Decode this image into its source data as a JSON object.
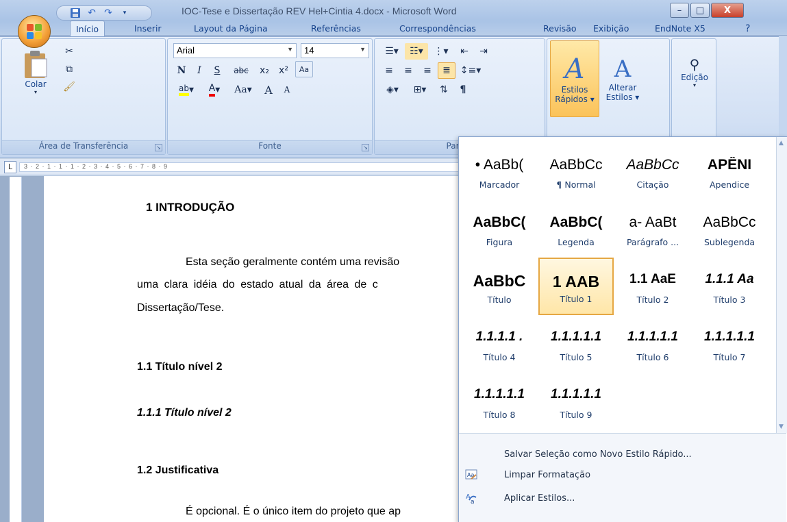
{
  "window": {
    "title": "IOC-Tese e Dissertação REV Hel+Cintia 4.docx - Microsoft Word",
    "min_label": "–",
    "max_label": "□",
    "close_label": "X"
  },
  "qat": {
    "save_icon": "save-icon",
    "undo_icon": "undo-icon",
    "redo_icon": "redo-icon"
  },
  "tabs": [
    {
      "label": "Início",
      "active": true
    },
    {
      "label": "Inserir"
    },
    {
      "label": "Layout da Página"
    },
    {
      "label": "Referências"
    },
    {
      "label": "Correspondências"
    },
    {
      "label": "Revisão"
    },
    {
      "label": "Exibição"
    },
    {
      "label": "EndNote X5"
    }
  ],
  "ribbon": {
    "clipboard": {
      "label": "Área de Transferência",
      "paste": "Colar"
    },
    "font": {
      "label": "Fonte",
      "family": "Arial",
      "size": "14",
      "bold": "N",
      "italic": "I",
      "underline": "S",
      "strike": "abc",
      "sub": "x₂",
      "sup": "x²",
      "change_case": "Aa",
      "grow": "A",
      "shrink": "A"
    },
    "paragraph": {
      "label": "Parágr"
    },
    "styles": {
      "quick_line1": "Estilos",
      "quick_line2": "Rápidos",
      "change_line1": "Alterar",
      "change_line2": "Estilos"
    },
    "editing": {
      "label": "Edição"
    }
  },
  "ruler": {
    "marks": "3 · 2 · 1 · 1 ·   1 · 2 · 3 · 4 · 5 · 6 · 7 · 8 · 9"
  },
  "document": {
    "h1": "1   INTRODUÇÃO",
    "p1_line1": "Esta seção geralmente contém uma revisão",
    "p1_line2": "uma clara idéia do estado atual da área de c",
    "p1_line3": "Dissertação/Tese.",
    "h2a": "1.1   Título nível 2",
    "h3": "1.1.1  Título nível 2",
    "h2b": "1.2   Justificativa",
    "p2": "É opcional. É o único item do projeto que ap"
  },
  "styles_gallery": [
    {
      "preview": "• AaBb(",
      "name": "Marcador"
    },
    {
      "preview": "AaBbCc",
      "name": "¶ Normal"
    },
    {
      "preview": "AaBbCc",
      "name": "Citação"
    },
    {
      "preview": "APÊNI",
      "name": "Apendice"
    },
    {
      "preview": "AaBbC(",
      "name": "Figura"
    },
    {
      "preview": "AaBbC(",
      "name": "Legenda"
    },
    {
      "preview": "a- AaBt",
      "name": "Parágrafo ..."
    },
    {
      "preview": "AaBbCc",
      "name": "Sublegenda"
    },
    {
      "preview": "AaBbC",
      "name": "Título"
    },
    {
      "preview": "1  AAB",
      "name": "Título 1",
      "selected": true
    },
    {
      "preview": "1.1  AaE",
      "name": "Título 2"
    },
    {
      "preview": "1.1.1  Aa",
      "name": "Título 3"
    },
    {
      "preview": "1.1.1.1 .",
      "name": "Título 4"
    },
    {
      "preview": "1.1.1.1.1",
      "name": "Título 5"
    },
    {
      "preview": "1.1.1.1.1",
      "name": "Título 6"
    },
    {
      "preview": "1.1.1.1.1",
      "name": "Título 7"
    },
    {
      "preview": "1.1.1.1.1",
      "name": "Título 8"
    },
    {
      "preview": "1.1.1.1.1",
      "name": "Título 9"
    }
  ],
  "gallery_menu": [
    {
      "label": "Salvar Seleção como Novo Estilo Rápido...",
      "icon": ""
    },
    {
      "label": "Limpar Formatação",
      "icon": "clear-formatting-icon"
    },
    {
      "label": "Aplicar Estilos...",
      "icon": "apply-styles-icon"
    }
  ]
}
